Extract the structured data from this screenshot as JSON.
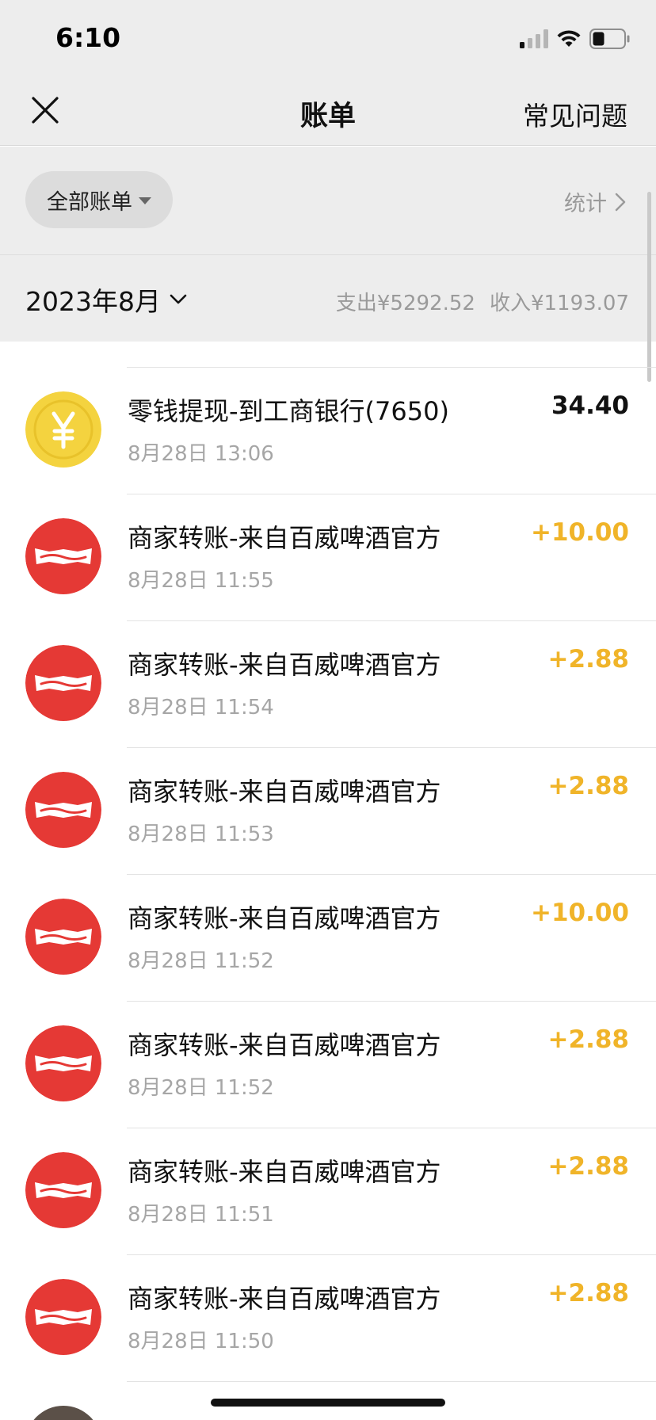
{
  "status": {
    "time": "6:10"
  },
  "nav": {
    "title": "账单",
    "faq": "常见问题"
  },
  "filter": {
    "label": "全部账单",
    "stats": "统计"
  },
  "month": {
    "label": "2023年8月",
    "expense": "支出¥5292.52",
    "income": "收入¥1193.07"
  },
  "colors": {
    "income": "#f0b429",
    "budweiser_red": "#e53935",
    "coin_yellow": "#f4d33f"
  },
  "transactions": [
    {
      "title": "零钱提现-到工商银行(7650)",
      "time": "8月28日 13:06",
      "amount": "34.40",
      "icon": "yuan-coin-icon",
      "type": "neutral"
    },
    {
      "title": "商家转账-来自百威啤酒官方",
      "time": "8月28日 11:55",
      "amount": "+10.00",
      "icon": "budweiser-logo",
      "type": "income"
    },
    {
      "title": "商家转账-来自百威啤酒官方",
      "time": "8月28日 11:54",
      "amount": "+2.88",
      "icon": "budweiser-logo",
      "type": "income"
    },
    {
      "title": "商家转账-来自百威啤酒官方",
      "time": "8月28日 11:53",
      "amount": "+2.88",
      "icon": "budweiser-logo",
      "type": "income"
    },
    {
      "title": "商家转账-来自百威啤酒官方",
      "time": "8月28日 11:52",
      "amount": "+10.00",
      "icon": "budweiser-logo",
      "type": "income"
    },
    {
      "title": "商家转账-来自百威啤酒官方",
      "time": "8月28日 11:52",
      "amount": "+2.88",
      "icon": "budweiser-logo",
      "type": "income"
    },
    {
      "title": "商家转账-来自百威啤酒官方",
      "time": "8月28日 11:51",
      "amount": "+2.88",
      "icon": "budweiser-logo",
      "type": "income"
    },
    {
      "title": "商家转账-来自百威啤酒官方",
      "time": "8月28日 11:50",
      "amount": "+2.88",
      "icon": "budweiser-logo",
      "type": "income"
    }
  ]
}
